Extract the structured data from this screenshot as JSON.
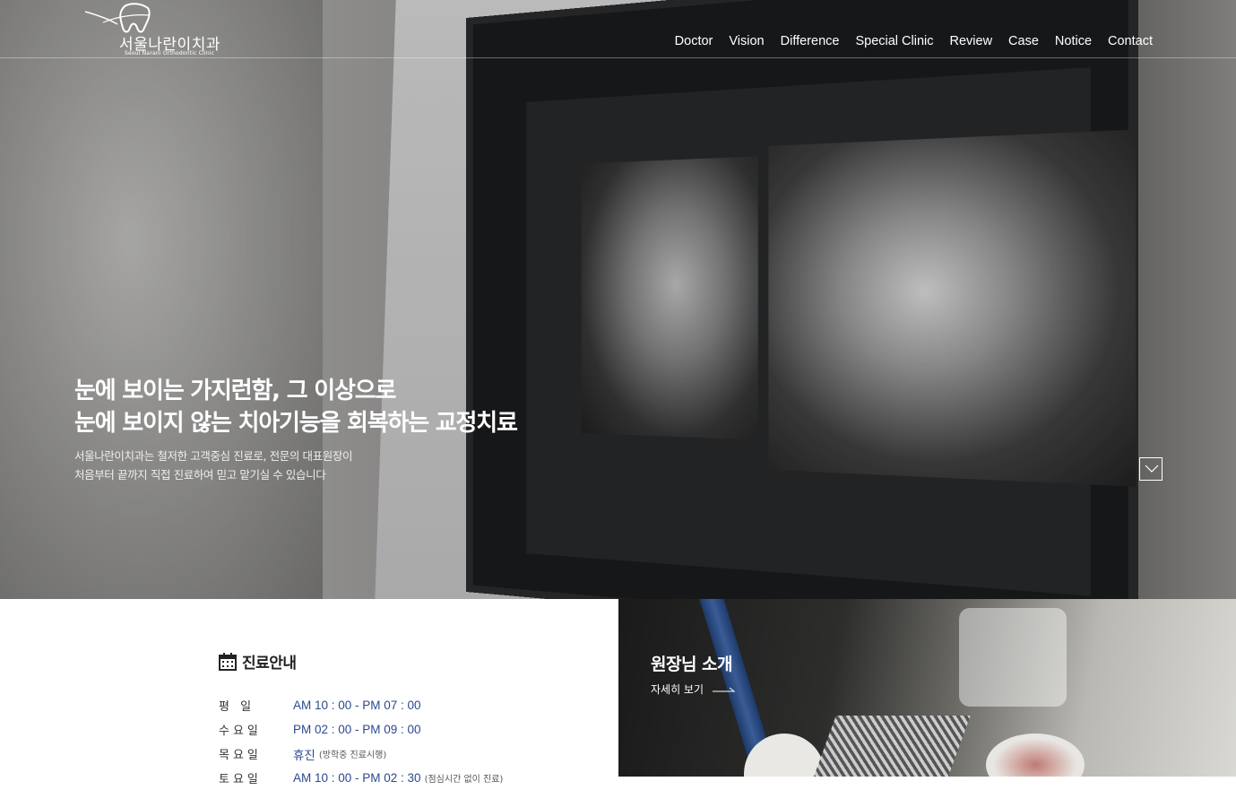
{
  "logo": {
    "name": "서울나란이치과",
    "sub": "Seoul Narani Orthodontic Clinic"
  },
  "nav": [
    "Doctor",
    "Vision",
    "Difference",
    "Special Clinic",
    "Review",
    "Case",
    "Notice",
    "Contact"
  ],
  "hero": {
    "headline_1": "눈에 보이는 가지런함, 그 이상으로",
    "headline_2": "눈에 보이지 않는 치아기능을 회복하는 교정치료",
    "desc_1": "서울나란이치과는 철저한 고객중심 진료로, 전문의 대표원장이",
    "desc_2": "처음부터 끝까지 직접 진료하여 믿고 맡기실 수 있습니다"
  },
  "hours": {
    "title": "진료안내",
    "rows": [
      {
        "day": "평   일",
        "time": "AM 10 : 00  -  PM 07 : 00",
        "note": ""
      },
      {
        "day": "수요일",
        "time": "PM 02 : 00  -  PM 09 : 00",
        "note": ""
      },
      {
        "day": "목요일",
        "time": "휴진",
        "note": "(방학중 진료시행)"
      },
      {
        "day": "토요일",
        "time": "AM 10 : 00  -  PM 02 : 30",
        "note": "(점심시간 없이 진료)"
      }
    ]
  },
  "doctor": {
    "title": "원장님 소개",
    "link": "자세히 보기"
  }
}
